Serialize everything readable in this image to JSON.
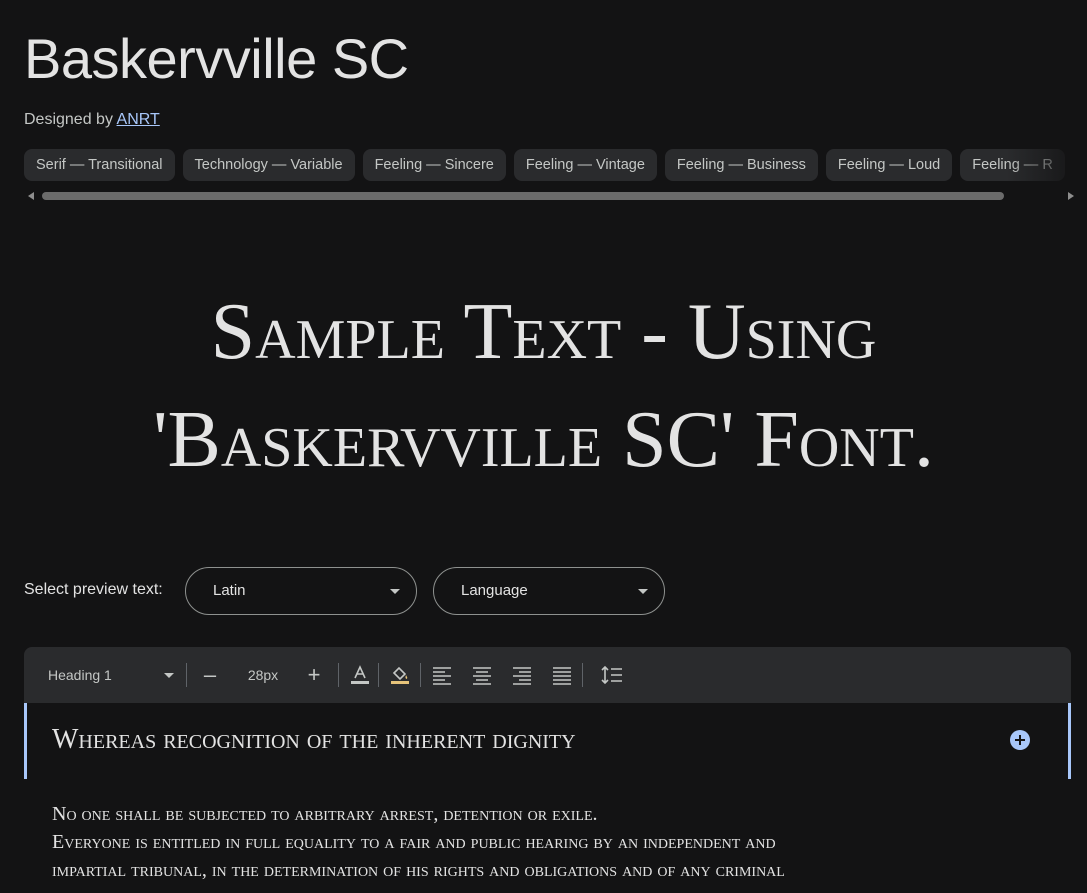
{
  "font": {
    "title": "Baskervville SC",
    "designed_by_label": "Designed by",
    "designer": "ANRT"
  },
  "tags": [
    "Serif — Transitional",
    "Technology — Variable",
    "Feeling — Sincere",
    "Feeling — Vintage",
    "Feeling — Business",
    "Feeling — Loud",
    "Feeling — R"
  ],
  "sample_text": {
    "line1": "Sample Text - Using",
    "line2": "'Baskervville SC' Font."
  },
  "preview_controls": {
    "label": "Select preview text:",
    "script_value": "Latin",
    "language_value": "Language"
  },
  "toolbar": {
    "style_value": "Heading 1",
    "minus": "–",
    "size_value": "28px",
    "plus": "+",
    "icons": [
      "text-color-icon",
      "fill-color-icon",
      "align-left-icon",
      "align-center-icon",
      "align-right-icon",
      "align-justify-icon",
      "line-height-icon"
    ]
  },
  "preview": {
    "heading": "Whereas recognition of the inherent dignity",
    "body_lines": [
      "No one shall be subjected to arbitrary arrest, detention or exile.",
      "Everyone is entitled in full equality to a fair and public hearing by an independent and",
      "impartial tribunal, in the determination of his rights and obligations and of any criminal"
    ]
  },
  "colors": {
    "background": "#131314",
    "surface": "#2a2b2d",
    "accent": "#a8c7fa",
    "text": "#e3e3e3"
  }
}
